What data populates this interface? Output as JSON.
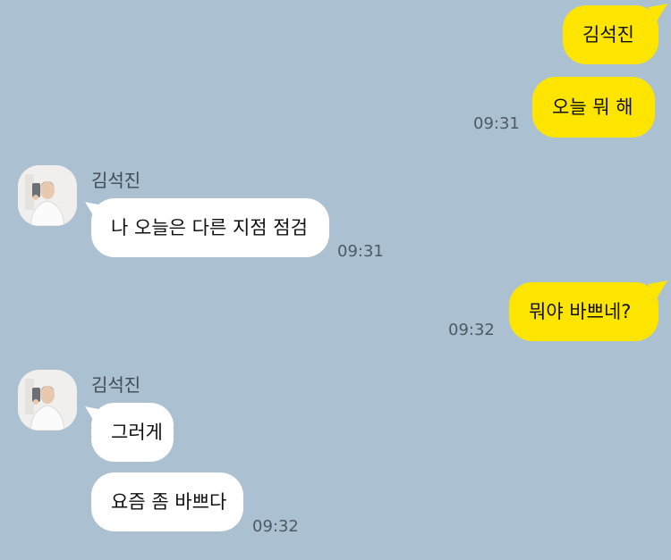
{
  "messages": {
    "m1": {
      "text": "김석진"
    },
    "m2": {
      "text": "오늘 뭐 해",
      "time": "09:31"
    },
    "m3": {
      "sender": "김석진",
      "text": "나 오늘은 다른 지점 점검",
      "time": "09:31"
    },
    "m4": {
      "text": "뭐야 바쁘네?",
      "time": "09:32"
    },
    "m5": {
      "sender": "김석진",
      "text": "그러게"
    },
    "m6": {
      "text": "요즘 좀 바쁘다",
      "time": "09:32"
    }
  },
  "colors": {
    "background": "#abc1d1",
    "my_bubble": "#fee500",
    "other_bubble": "#ffffff"
  }
}
